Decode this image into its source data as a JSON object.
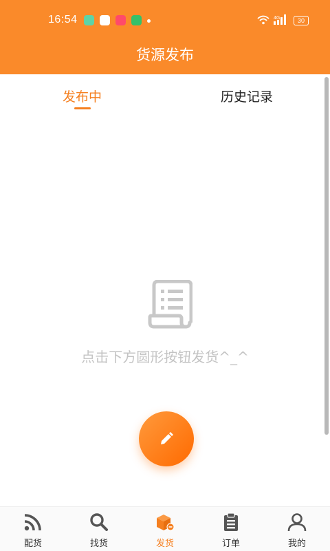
{
  "status_bar": {
    "time": "16:54",
    "network": "4G",
    "battery": "30",
    "app_icon_colors": [
      "#5fd3a6",
      "#ffffff",
      "#ff4a6a",
      "#35c06a"
    ]
  },
  "header": {
    "title": "货源发布"
  },
  "tabs": [
    {
      "label": "发布中",
      "active": true
    },
    {
      "label": "历史记录",
      "active": false
    }
  ],
  "empty_state": {
    "icon": "receipt-scroll-icon",
    "message": "点击下方圆形按钮发货^_^"
  },
  "fab": {
    "icon": "pencil-icon"
  },
  "bottom_nav": [
    {
      "label": "配货",
      "icon": "rss-feed-icon",
      "active": false
    },
    {
      "label": "找货",
      "icon": "search-icon",
      "active": false
    },
    {
      "label": "发货",
      "icon": "package-icon",
      "active": true
    },
    {
      "label": "订单",
      "icon": "clipboard-icon",
      "active": false
    },
    {
      "label": "我的",
      "icon": "user-icon",
      "active": false
    }
  ],
  "colors": {
    "brand": "#fa8a2a",
    "accent": "#f57f1f",
    "nav_icon": "#555555",
    "empty_text": "#c4c4c4"
  }
}
